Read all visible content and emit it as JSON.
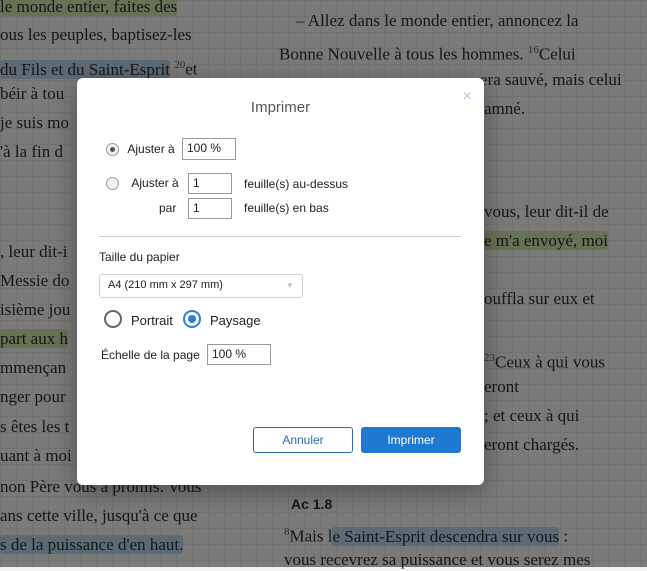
{
  "background": {
    "left_lines": [
      "le monde entier, faites des",
      "ous les peuples, baptisez-les",
      "du Fils et du Saint-Esprit",
      "béir à tou",
      "je suis mo",
      "'à la fin d",
      ", leur dit-i",
      "Messie do",
      "isième jou",
      "part aux h",
      "mmençan",
      "nger pour",
      "s êtes les t",
      "uant à moi",
      "non Père vous a promis. Vous",
      "ans cette ville, jusqu'à ce que",
      "s de la puissance d'en haut."
    ],
    "left_sup_20": "20",
    "left_et": "et",
    "right_lines": [
      "– Allez dans le monde entier, annoncez la",
      "Bonne Nouvelle à tous les hommes.",
      "Celui",
      "era sauvé, mais celui",
      "amné.",
      "vous, leur dit-il de",
      "e m'a envoyé, moi",
      "ouffla sur eux et",
      "Ceux à qui vous",
      "eront",
      "; et ceux à qui",
      "eront chargés."
    ],
    "right_sup_16": "16",
    "right_sup_23": "23",
    "ref_heading": "Ac 1.8",
    "ref_sup_8": "8",
    "ref_line_1_pre": "Mais l",
    "ref_line_1_hl": "e Saint-Esprit descendra sur vous",
    "ref_line_1_post": " :",
    "ref_line_2": "vous recevrez sa puissance et vous serez mes"
  },
  "dialog": {
    "title": "Imprimer",
    "close_icon": "×",
    "fit_label": "Ajuster à",
    "fit_value": "100 %",
    "fit_pages_label": "Ajuster à",
    "fit_pages_wide_value": "1",
    "fit_pages_wide_suffix": "feuille(s) au-dessus",
    "fit_pages_tall_label": "par",
    "fit_pages_tall_value": "1",
    "fit_pages_tall_suffix": "feuille(s) en bas",
    "paper_size_label": "Taille du papier",
    "paper_size_value": "A4 (210 mm x 297 mm)",
    "orientation_portrait": "Portrait",
    "orientation_landscape": "Paysage",
    "page_scale_label": "Échelle de la page",
    "page_scale_value": "100 %",
    "cancel_label": "Annuler",
    "print_label": "Imprimer"
  },
  "colors": {
    "primary": "#1f78d1",
    "highlight_green": "#cfe3a8",
    "highlight_blue": "#b7d5ea",
    "highlight_orange": "#f4c7a2"
  }
}
